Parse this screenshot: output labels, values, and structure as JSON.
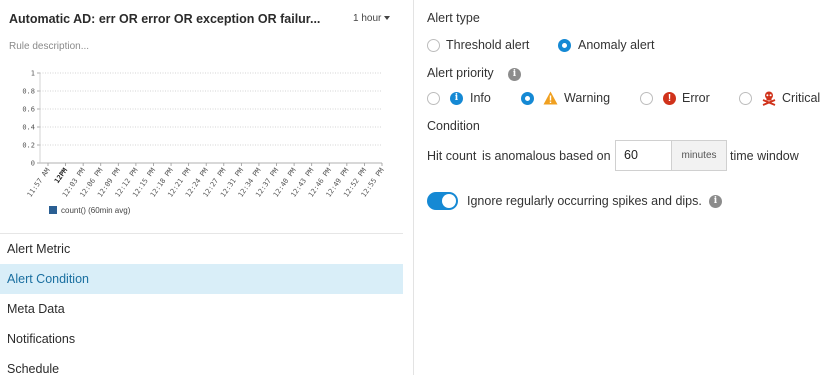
{
  "rule": {
    "title": "Automatic AD: err OR error OR exception OR failur...",
    "time_range": "1 hour",
    "description_placeholder": "Rule description..."
  },
  "chart_data": {
    "type": "line",
    "y_ticks": [
      "1",
      "0.8",
      "0.6",
      "0.4",
      "0.2",
      "0"
    ],
    "ylim": [
      0,
      1
    ],
    "x_ticks": [
      "11:57 AM",
      "12PM",
      "12:03 PM",
      "12:06 PM",
      "12:09 PM",
      "12:12 PM",
      "12:15 PM",
      "12:18 PM",
      "12:21 PM",
      "12:24 PM",
      "12:27 PM",
      "12:31 PM",
      "12:34 PM",
      "12:37 PM",
      "12:40 PM",
      "12:43 PM",
      "12:46 PM",
      "12:49 PM",
      "12:52 PM",
      "12:55 PM"
    ],
    "bold_tick": "12PM",
    "grid": true,
    "series": [
      {
        "name": "count() (60min avg)",
        "color": "#2a5f93",
        "values": []
      }
    ],
    "legend_position": "bottom-left"
  },
  "nav": {
    "items": [
      "Alert Metric",
      "Alert Condition",
      "Meta Data",
      "Notifications",
      "Schedule"
    ],
    "active": "Alert Condition"
  },
  "alert_type": {
    "label": "Alert type",
    "threshold": "Threshold alert",
    "anomaly": "Anomaly alert",
    "selected": "Anomaly alert"
  },
  "alert_priority": {
    "label": "Alert priority",
    "info": "Info",
    "warning": "Warning",
    "error": "Error",
    "critical": "Critical",
    "selected": "Warning"
  },
  "condition": {
    "label": "Condition",
    "prefix": "Hit count",
    "middle": "is anomalous based on",
    "value": "60",
    "unit": "minutes",
    "suffix": "time window"
  },
  "ignore_spikes": {
    "label": "Ignore regularly occurring spikes and dips.",
    "enabled": true
  },
  "colors": {
    "accent": "#1589d4",
    "active_nav_bg": "#d9eef8",
    "warning": "#f0a020",
    "error": "#d0321b",
    "critical": "#d0321b"
  }
}
